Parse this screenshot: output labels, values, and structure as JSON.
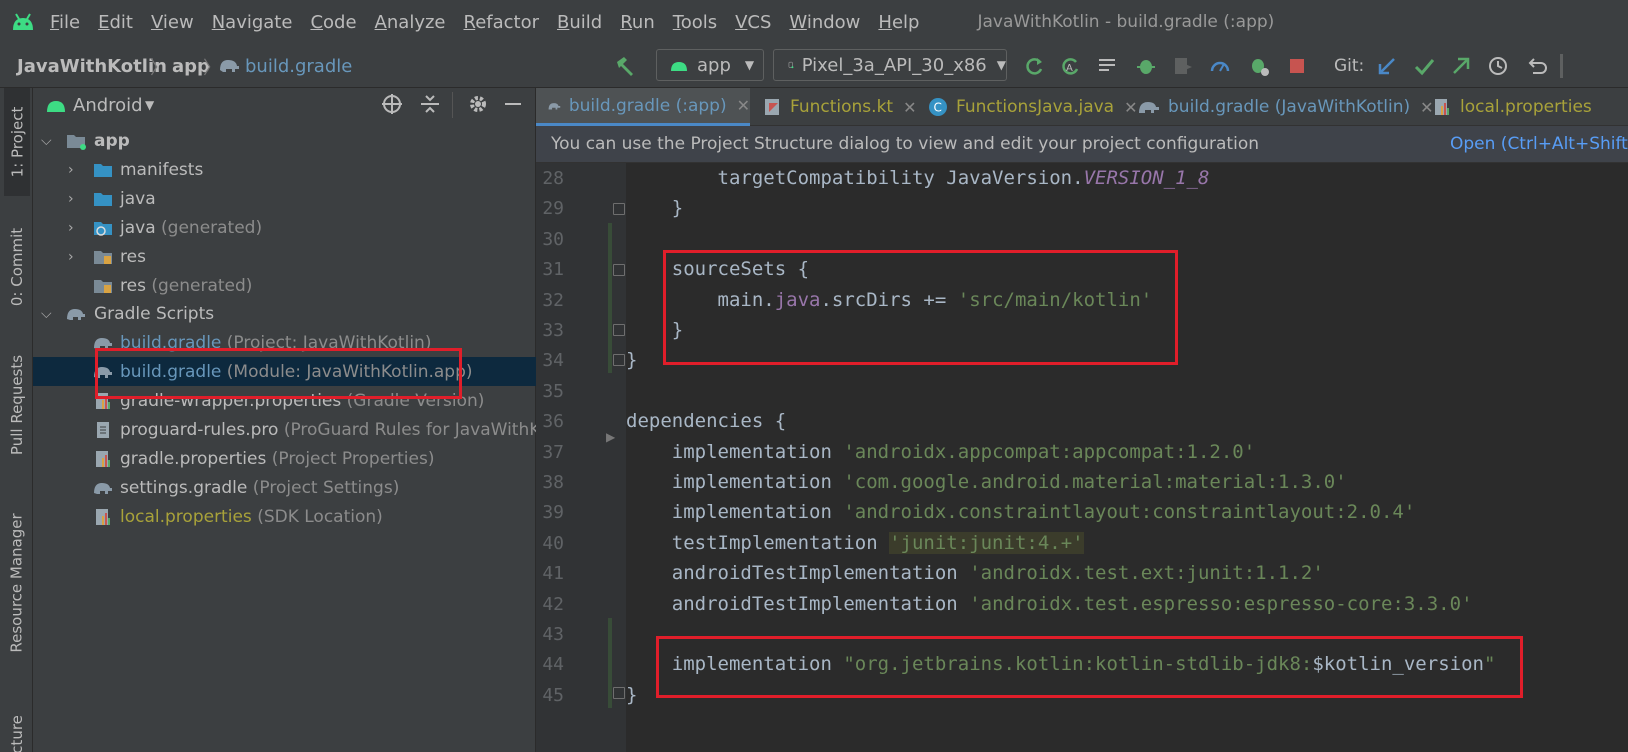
{
  "menubar": {
    "items": [
      "File",
      "Edit",
      "View",
      "Navigate",
      "Code",
      "Analyze",
      "Refactor",
      "Build",
      "Run",
      "Tools",
      "VCS",
      "Window",
      "Help"
    ],
    "window_title": "JavaWithKotlin - build.gradle (:app)"
  },
  "navbar": {
    "crumb_project": "JavaWithKotlin",
    "crumb_module": "app",
    "crumb_file": "build.gradle",
    "run_config": "app",
    "device": "Pixel_3a_API_30_x86",
    "git_label": "Git:"
  },
  "left_strip": {
    "project_tab": "1: Project",
    "commit_tab": "0: Commit",
    "pull_requests_tab": "Pull Requests",
    "resource_manager_tab": "Resource Manager",
    "structure_tab": "Structure"
  },
  "project_panel": {
    "view_selector": "Android",
    "tree": [
      {
        "label": "app",
        "secondary": ""
      },
      {
        "label": "manifests",
        "secondary": ""
      },
      {
        "label": "java",
        "secondary": ""
      },
      {
        "label": "java",
        "secondary": "(generated)"
      },
      {
        "label": "res",
        "secondary": ""
      },
      {
        "label": "res",
        "secondary": "(generated)"
      },
      {
        "label": "Gradle Scripts",
        "secondary": ""
      },
      {
        "label": "build.gradle",
        "secondary": "(Project: JavaWithKotlin)"
      },
      {
        "label": "build.gradle",
        "secondary": "(Module: JavaWithKotlin.app)"
      },
      {
        "label": "gradle-wrapper.properties",
        "secondary": "(Gradle Version)"
      },
      {
        "label": "proguard-rules.pro",
        "secondary": "(ProGuard Rules for JavaWithKotlin)"
      },
      {
        "label": "gradle.properties",
        "secondary": "(Project Properties)"
      },
      {
        "label": "settings.gradle",
        "secondary": "(Project Settings)"
      },
      {
        "label": "local.properties",
        "secondary": "(SDK Location)"
      }
    ]
  },
  "editor_tabs": [
    {
      "label": "build.gradle (:app)"
    },
    {
      "label": "Functions.kt"
    },
    {
      "label": "FunctionsJava.java"
    },
    {
      "label": "build.gradle (JavaWithKotlin)"
    },
    {
      "label": "local.properties"
    }
  ],
  "notice": {
    "message": "You can use the Project Structure dialog to view and edit your project configuration",
    "action": "Open (Ctrl+Alt+Shift+S)"
  },
  "editor": {
    "lines": [
      {
        "num": "28",
        "indent": "        ",
        "a": "targetCompatibility JavaVersion.",
        "field": "VERSION_1_8"
      },
      {
        "num": "29",
        "indent": "    ",
        "a": "}"
      },
      {
        "num": "30",
        "indent": "",
        "a": ""
      },
      {
        "num": "31",
        "indent": "    ",
        "a": "sourceSets {"
      },
      {
        "num": "32",
        "indent": "        ",
        "a": "main.",
        "java": "java",
        "b": ".srcDirs += ",
        "str": "'src/main/kotlin'"
      },
      {
        "num": "33",
        "indent": "    ",
        "a": "}"
      },
      {
        "num": "34",
        "indent": "",
        "a": "}"
      },
      {
        "num": "35",
        "indent": "",
        "a": ""
      },
      {
        "num": "36",
        "indent": "",
        "a": "dependencies {"
      },
      {
        "num": "37",
        "indent": "    ",
        "a": "implementation ",
        "str": "'androidx.appcompat:appcompat:1.2.0'"
      },
      {
        "num": "38",
        "indent": "    ",
        "a": "implementation ",
        "str": "'com.google.android.material:material:1.3.0'"
      },
      {
        "num": "39",
        "indent": "    ",
        "a": "implementation ",
        "str": "'androidx.constraintlayout:constraintlayout:2.0.4'"
      },
      {
        "num": "40",
        "indent": "    ",
        "a": "testImplementation ",
        "str_hl": "'junit:junit:4.+'"
      },
      {
        "num": "41",
        "indent": "    ",
        "a": "androidTestImplementation ",
        "str": "'androidx.test.ext:junit:1.1.2'"
      },
      {
        "num": "42",
        "indent": "    ",
        "a": "androidTestImplementation ",
        "str": "'androidx.test.espresso:espresso-core:3.3.0'"
      },
      {
        "num": "43",
        "indent": "",
        "a": ""
      },
      {
        "num": "44",
        "indent": "    ",
        "a": "implementation ",
        "str": "\"org.jetbrains.kotlin:kotlin-stdlib-jdk8:",
        "b": "$kotlin_version",
        "str2": "\""
      },
      {
        "num": "45",
        "indent": "",
        "a": "}"
      }
    ]
  },
  "colors": {
    "highlight_box": "#e01e2a",
    "accent_blue": "#4a88c7",
    "android_green": "#3ddc84"
  }
}
